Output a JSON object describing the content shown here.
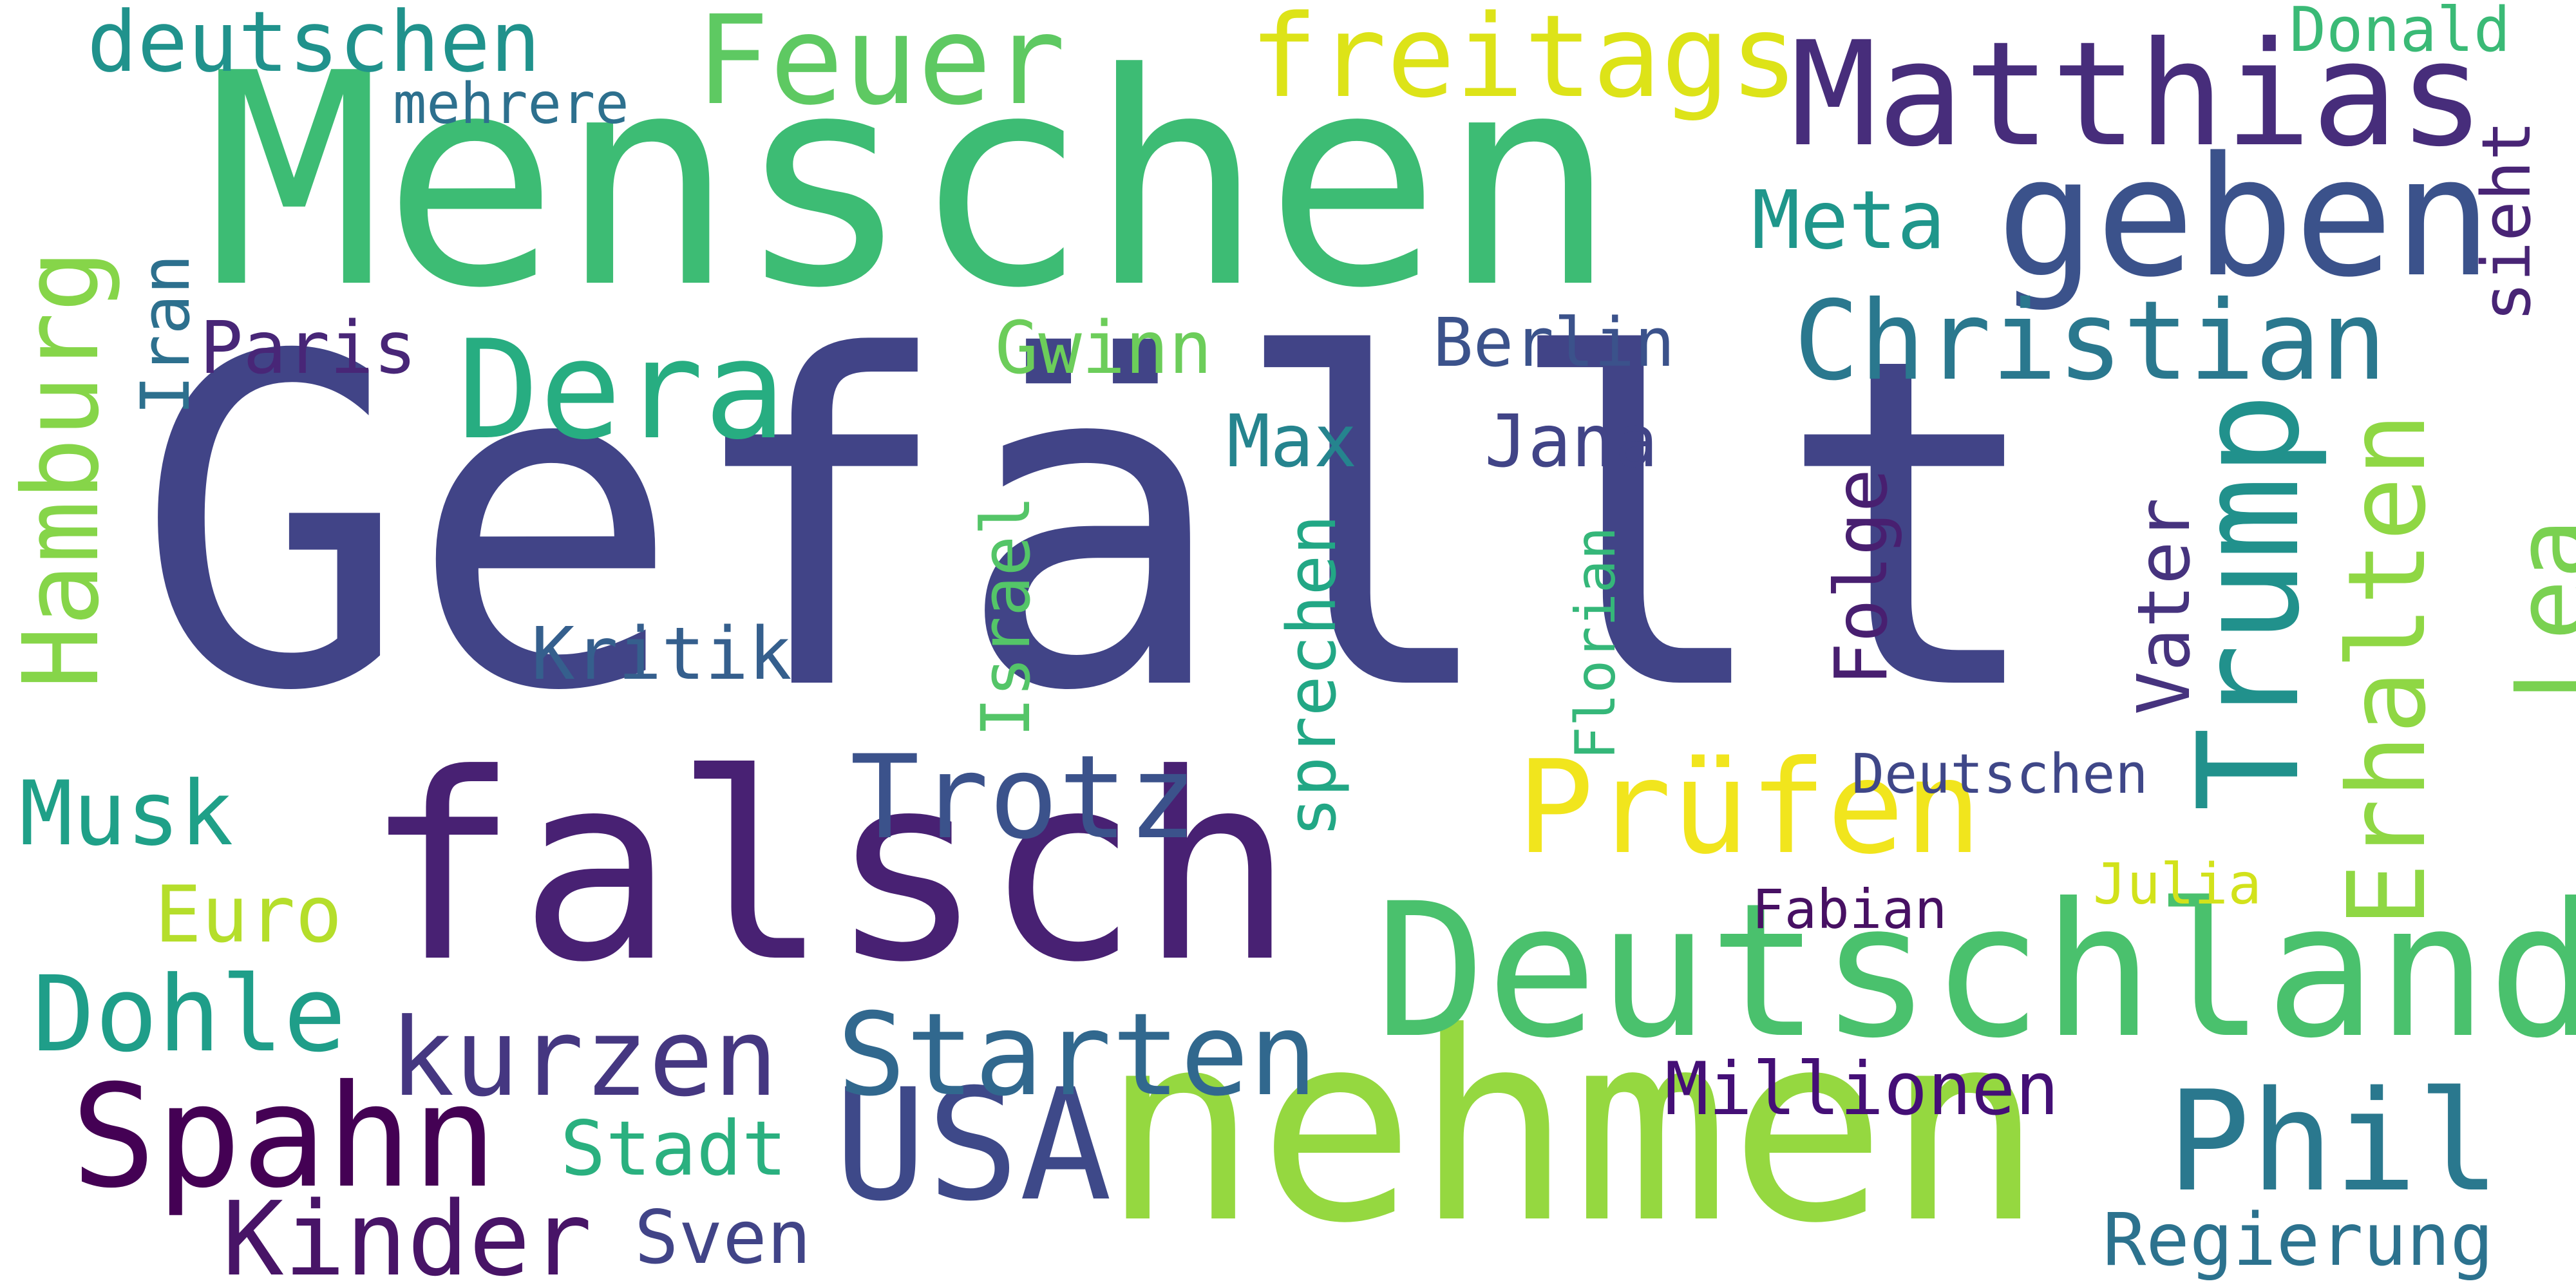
{
  "words": [
    {
      "text": "Gefällt",
      "color": "#414487"
    },
    {
      "text": "Menschen",
      "color": "#3dbc74"
    },
    {
      "text": "falsch",
      "color": "#482173"
    },
    {
      "text": "nehmen",
      "color": "#95d840"
    },
    {
      "text": "Deutschland",
      "color": "#4ac16d"
    },
    {
      "text": "Trump",
      "color": "#21918c"
    },
    {
      "text": "Matthias",
      "color": "#472d7b"
    },
    {
      "text": "geben",
      "color": "#3b528b"
    },
    {
      "text": "Erhalten",
      "color": "#8fd744"
    },
    {
      "text": "Lea",
      "color": "#7ad151"
    },
    {
      "text": "Hamburg",
      "color": "#86d549"
    },
    {
      "text": "Feuer",
      "color": "#5ec962"
    },
    {
      "text": "freitags",
      "color": "#dde318"
    },
    {
      "text": "Spahn",
      "color": "#440154"
    },
    {
      "text": "USA",
      "color": "#3e4989"
    },
    {
      "text": "Phil",
      "color": "#2a788e"
    },
    {
      "text": "Dera",
      "color": "#27ad81"
    },
    {
      "text": "Christian",
      "color": "#2a788e"
    },
    {
      "text": "Prüfen",
      "color": "#f1e51d"
    },
    {
      "text": "Starten",
      "color": "#31688e"
    },
    {
      "text": "Trotz",
      "color": "#3b528b"
    },
    {
      "text": "kurzen",
      "color": "#453781"
    },
    {
      "text": "Kinder",
      "color": "#481467"
    },
    {
      "text": "Dohle",
      "color": "#1f9e89"
    },
    {
      "text": "deutschen",
      "color": "#20928c"
    },
    {
      "text": "Musk",
      "color": "#1fa088"
    },
    {
      "text": "Meta",
      "color": "#1f968b"
    },
    {
      "text": "Stadt",
      "color": "#2ab07f"
    },
    {
      "text": "Sven",
      "color": "#414487"
    },
    {
      "text": "Regierung",
      "color": "#2c728e"
    },
    {
      "text": "Millionen",
      "color": "#440f76"
    },
    {
      "text": "Euro",
      "color": "#b5de2b"
    },
    {
      "text": "Paris",
      "color": "#482677"
    },
    {
      "text": "Kritik",
      "color": "#355f8d"
    },
    {
      "text": "Jana",
      "color": "#414487"
    },
    {
      "text": "Max",
      "color": "#25848e"
    },
    {
      "text": "Berlin",
      "color": "#3b528b"
    },
    {
      "text": "Gwinn",
      "color": "#6ccd5a"
    },
    {
      "text": "Vater",
      "color": "#46337e"
    },
    {
      "text": "Folge",
      "color": "#481f70"
    },
    {
      "text": "sprechen",
      "color": "#22a785"
    },
    {
      "text": "Israel",
      "color": "#54c568"
    },
    {
      "text": "Florian",
      "color": "#35b779"
    },
    {
      "text": "Iran",
      "color": "#2d708e"
    },
    {
      "text": "sieht",
      "color": "#482475"
    },
    {
      "text": "Deutschen",
      "color": "#3f4788"
    },
    {
      "text": "Fabian",
      "color": "#471063"
    },
    {
      "text": "Julia",
      "color": "#d2e21b"
    },
    {
      "text": "Donald",
      "color": "#3aba76"
    },
    {
      "text": "mehrere",
      "color": "#2d708e"
    }
  ]
}
